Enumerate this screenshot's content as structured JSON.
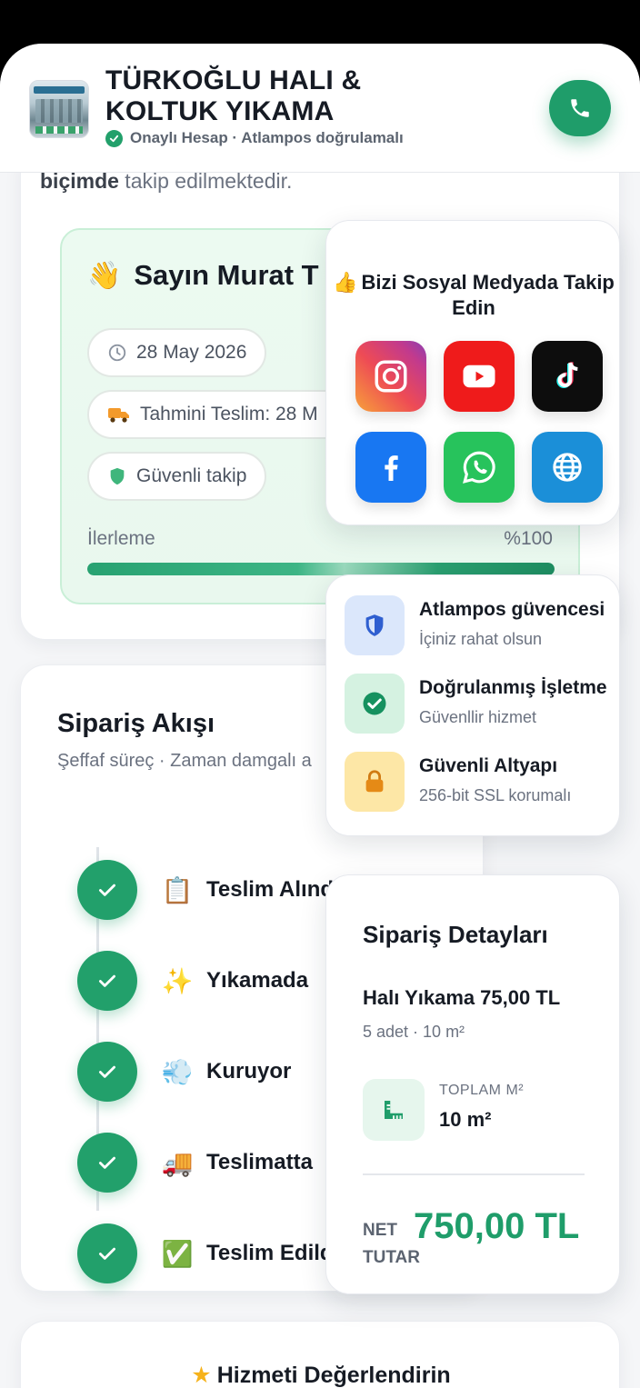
{
  "header": {
    "shop_name": "TÜRKOĞLU HALI & KOLTUK YIKAMA",
    "verified_text": "Onaylı Hesap · Atlampos doğrulamalı"
  },
  "intro": {
    "bold": "biçimde",
    "rest": " takip edilmektedir."
  },
  "greeting": {
    "title": "Sayın Murat T",
    "date": "28 May 2026",
    "delivery": "Tahmini Teslim: 28 M",
    "secure": "Güvenli takip",
    "progress_label": "İlerleme",
    "progress_value": "%100",
    "progress_fraction": 1.0
  },
  "flow": {
    "title": "Sipariş Akışı",
    "subtitle": "Şeffaf süreç · Zaman damgalı a",
    "steps": [
      {
        "emoji": "📋",
        "label": "Teslim Alındı"
      },
      {
        "emoji": "✨",
        "label": "Yıkamada"
      },
      {
        "emoji": "💨",
        "label": "Kuruyor"
      },
      {
        "emoji": "🚚",
        "label": "Teslimatta"
      },
      {
        "emoji": "✅",
        "label": "Teslim Edild"
      }
    ]
  },
  "social": {
    "title": "Bizi Sosyal Medyada Takip Edin",
    "buttons": [
      "instagram",
      "youtube",
      "tiktok",
      "facebook",
      "whatsapp",
      "website"
    ]
  },
  "trust": [
    {
      "title": "Atlampos güvencesi",
      "sub": "İçiniz rahat olsun"
    },
    {
      "title": "Doğrulanmış İşletme",
      "sub": "Güvenllir hizmet"
    },
    {
      "title": "Güvenli Altyapı",
      "sub": "256-bit SSL korumalı"
    }
  ],
  "details": {
    "title": "Sipariş Detayları",
    "item_name": "Halı Yıkama",
    "item_price": "75,00 TL",
    "item_meta": "5 adet · 10 m²",
    "m2_label": "TOPLAM M²",
    "m2_value": "10 m²",
    "net_label": "NET TUTAR",
    "net_value": "750,00 TL"
  },
  "rating": {
    "title": "Hizmeti Değerlendirin"
  },
  "colors": {
    "brand_green": "#1f9d6a",
    "accent_yellow": "#f6b21b"
  }
}
